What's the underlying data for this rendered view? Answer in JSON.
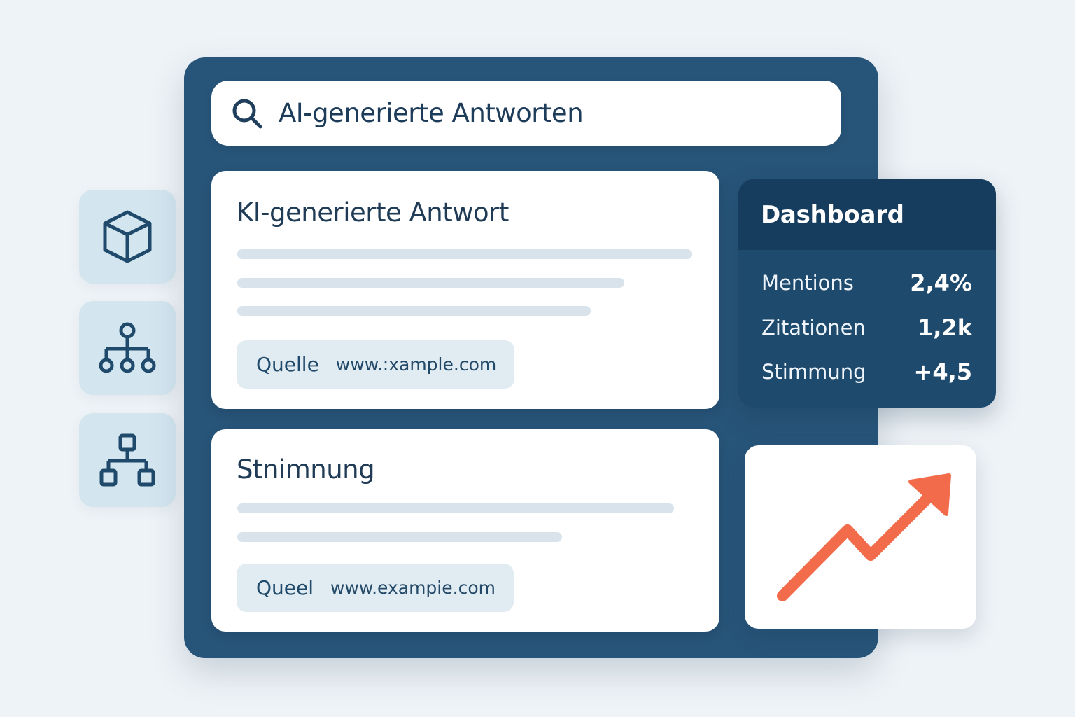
{
  "sidebar": {
    "icons": [
      {
        "name": "cube-icon"
      },
      {
        "name": "network-tree-icon"
      },
      {
        "name": "org-chart-icon"
      }
    ]
  },
  "search": {
    "icon": "search-icon",
    "query": "AI-generierte Antworten"
  },
  "results": [
    {
      "title": "KI-generierte Antwort",
      "source_label": "Quelle",
      "source_url": "www.:xample.com"
    },
    {
      "title": "Stnimnung",
      "source_label": "Queel",
      "source_url": "www.exampie.com"
    }
  ],
  "dashboard": {
    "title": "Dashboard",
    "metrics": [
      {
        "label": "Mentions",
        "value": "2,4%"
      },
      {
        "label": "Zitationen",
        "value": "1,2k"
      },
      {
        "label": "Stimmung",
        "value": "+4,5"
      }
    ]
  },
  "trend": {
    "icon": "trend-up-arrow-icon",
    "color": "#f26b4a"
  },
  "colors": {
    "panel": "#275479",
    "dashboard": "#1e4a6e",
    "accent": "#f26b4a",
    "tile": "#d3e6f0"
  }
}
